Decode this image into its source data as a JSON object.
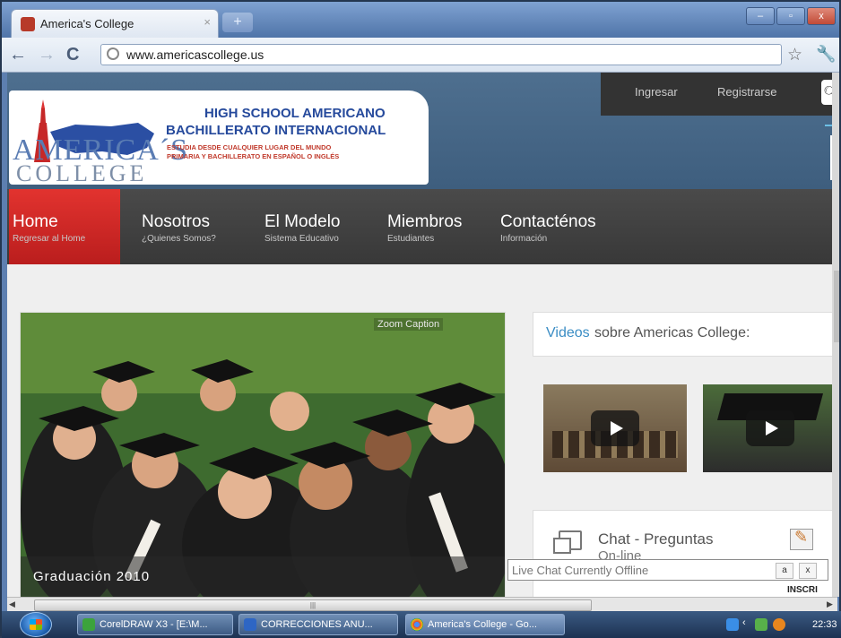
{
  "browser": {
    "tab_title": "America's College",
    "tab_close": "×",
    "new_tab": "+",
    "url": "www.americascollege.us",
    "window_buttons": [
      "–",
      "▫",
      "x"
    ]
  },
  "site": {
    "logo": {
      "brand_top": "AMERICA´S",
      "brand_bottom": "COLLEGE",
      "line1": "HIGH SCHOOL AMERICANO",
      "line2": "BACHILLERATO INTERNACIONAL",
      "line3": "ESTUDIA DESDE CUALQUIER LUGAR DEL MUNDO",
      "line4": "PRIMARIA Y BACHILLERATO EN ESPAÑOL O INGLÉS"
    },
    "topnav": {
      "login": "Ingresar",
      "register": "Registrarse"
    },
    "menu": [
      {
        "label": "Home",
        "sub": "Regresar al Home"
      },
      {
        "label": "Nosotros",
        "sub": "¿Quienes Somos?"
      },
      {
        "label": "El Modelo",
        "sub": "Sistema Educativo"
      },
      {
        "label": "Miembros",
        "sub": "Estudiantes"
      },
      {
        "label": "Contacténos",
        "sub": "Información"
      }
    ],
    "slider": {
      "zoom_label": "Zoom Caption",
      "caption": "Graduación 2010"
    },
    "videos": {
      "title_highlight": "Videos",
      "title_rest": "sobre Americas College:"
    },
    "chat": {
      "title": "Chat - Preguntas",
      "subtitle": "On-line"
    },
    "livechat": {
      "status": "Live Chat Currently Offline",
      "minimize": "a",
      "close": "x"
    },
    "partial_label": "INSCRI"
  },
  "taskbar": {
    "tasks": [
      "CorelDRAW X3 - [E:\\M...",
      "CORRECCIONES ANU...",
      "America's College - Go..."
    ],
    "clock": "22:33"
  },
  "colors": {
    "accent_red": "#d62b27",
    "link_blue": "#3b8dc4",
    "nav_dark": "#3e3e3e"
  }
}
